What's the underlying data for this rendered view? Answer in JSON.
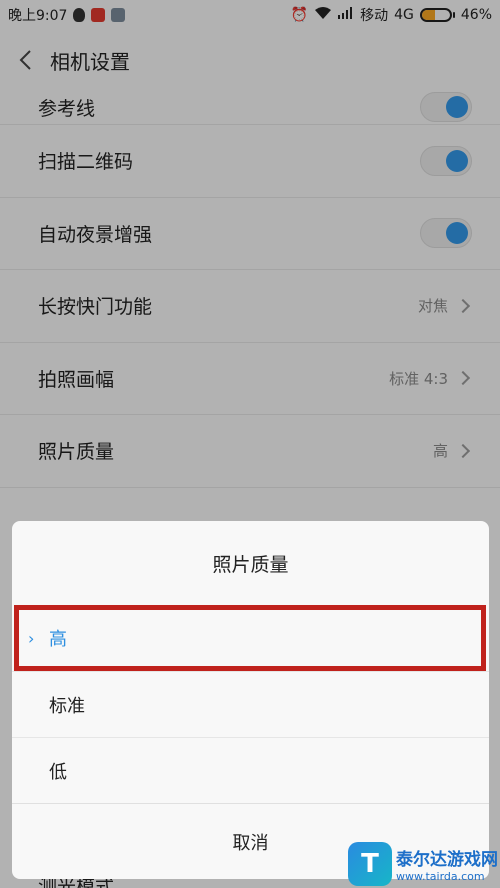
{
  "statusbar": {
    "time": "晚上9:07",
    "carrier": "移动",
    "network": "4G",
    "battery": "46%",
    "battery_level": 0.46
  },
  "header": {
    "back_icon": "chevron-left-icon",
    "title": "相机设置"
  },
  "settings": {
    "items": [
      {
        "label": "参考线",
        "type": "toggle",
        "on": true
      },
      {
        "label": "扫描二维码",
        "type": "toggle",
        "on": true
      },
      {
        "label": "自动夜景增强",
        "type": "toggle",
        "on": true
      },
      {
        "label": "长按快门功能",
        "type": "value",
        "value": "对焦"
      },
      {
        "label": "拍照画幅",
        "type": "value",
        "value": "标准 4:3"
      },
      {
        "label": "照片质量",
        "type": "value",
        "value": "高"
      }
    ],
    "partial_bottom_label": "测光模式"
  },
  "dialog": {
    "title": "照片质量",
    "options": [
      {
        "label": "高",
        "selected": true
      },
      {
        "label": "标准",
        "selected": false
      },
      {
        "label": "低",
        "selected": false
      }
    ],
    "cancel_label": "取消"
  },
  "colors": {
    "accent": "#2e8fe0",
    "highlight_border": "#c0221c",
    "battery": "#f5a623"
  },
  "watermark": {
    "name": "泰尔达游戏网",
    "url": "www.tairda.com",
    "logo_letter": "T"
  }
}
